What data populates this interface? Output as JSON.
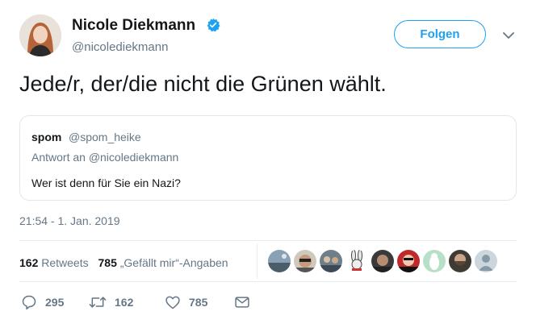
{
  "author": {
    "name": "Nicole Diekmann",
    "handle": "@nicolediekmann",
    "verified": true
  },
  "follow_button": {
    "label": "Folgen"
  },
  "tweet": {
    "text": "Jede/r, der/die nicht die Grünen wählt."
  },
  "quote": {
    "name": "spom",
    "handle": "@spom_heike",
    "reply_to": "Antwort an @nicolediekmann",
    "text": "Wer ist denn für Sie ein Nazi?"
  },
  "timestamp": "21:54 - 1. Jan. 2019",
  "stats": {
    "retweets_count": "162",
    "retweets_label": "Retweets",
    "likes_count": "785",
    "likes_label": "„Gefällt mir“-Angaben"
  },
  "liker_avatars": [
    "landscape-avatar",
    "sunglasses-avatar",
    "group-avatar",
    "bunny-avatar",
    "face-avatar",
    "red-avatar",
    "bird-avatar",
    "beard-avatar",
    "default-avatar"
  ],
  "actions": {
    "reply_count": "295",
    "retweet_count": "162",
    "like_count": "785"
  },
  "colors": {
    "accent": "#1da1f2",
    "muted": "#657786",
    "text": "#14171a",
    "border": "#e1e8ed"
  }
}
